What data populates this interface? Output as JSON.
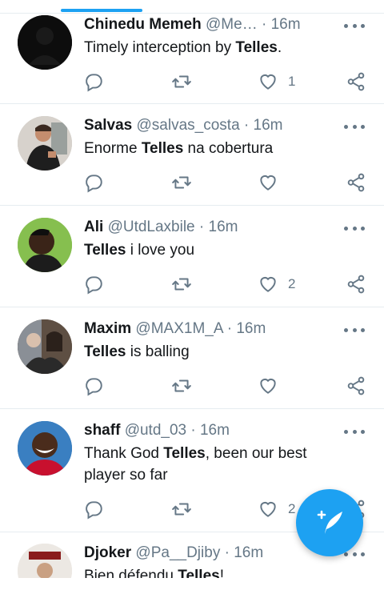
{
  "colors": {
    "accent": "#1da1f2",
    "text": "#14171a",
    "secondary": "#657786",
    "divider": "#e6ecf0"
  },
  "feed": {
    "tweets": [
      {
        "name": "Chinedu Memeh",
        "handle": "@Me…",
        "sep": "·",
        "time": "16m",
        "text_parts": [
          "Timely interception by ",
          "Telles",
          "."
        ],
        "likes": "1"
      },
      {
        "name": "Salvas",
        "handle": "@salvas_costa",
        "sep": "·",
        "time": "16m",
        "text_parts": [
          "Enorme ",
          "Telles",
          " na cobertura"
        ],
        "likes": ""
      },
      {
        "name": "Ali",
        "handle": "@UtdLaxbile",
        "sep": "·",
        "time": "16m",
        "text_parts": [
          "",
          "Telles",
          " i love you"
        ],
        "likes": "2"
      },
      {
        "name": "Maxim",
        "handle": "@MAX1M_A",
        "sep": "·",
        "time": "16m",
        "text_parts": [
          "",
          "Telles",
          " is balling"
        ],
        "likes": ""
      },
      {
        "name": "shaff",
        "handle": "@utd_03",
        "sep": "·",
        "time": "16m",
        "text_line1_parts": [
          "Thank God ",
          "Telles",
          ", been our best"
        ],
        "text_line2": "player so far",
        "likes": "2"
      },
      {
        "name": "Djoker",
        "handle": "@Pa__Djiby",
        "sep": "·",
        "time": "16m",
        "text_parts": [
          "Bien défendu ",
          "Telles",
          "!"
        ],
        "likes": ""
      }
    ]
  },
  "icons": {
    "reply": "reply-icon",
    "retweet": "retweet-icon",
    "like": "heart-icon",
    "share": "share-icon",
    "more": "more-options-icon",
    "compose": "compose-tweet-icon"
  }
}
